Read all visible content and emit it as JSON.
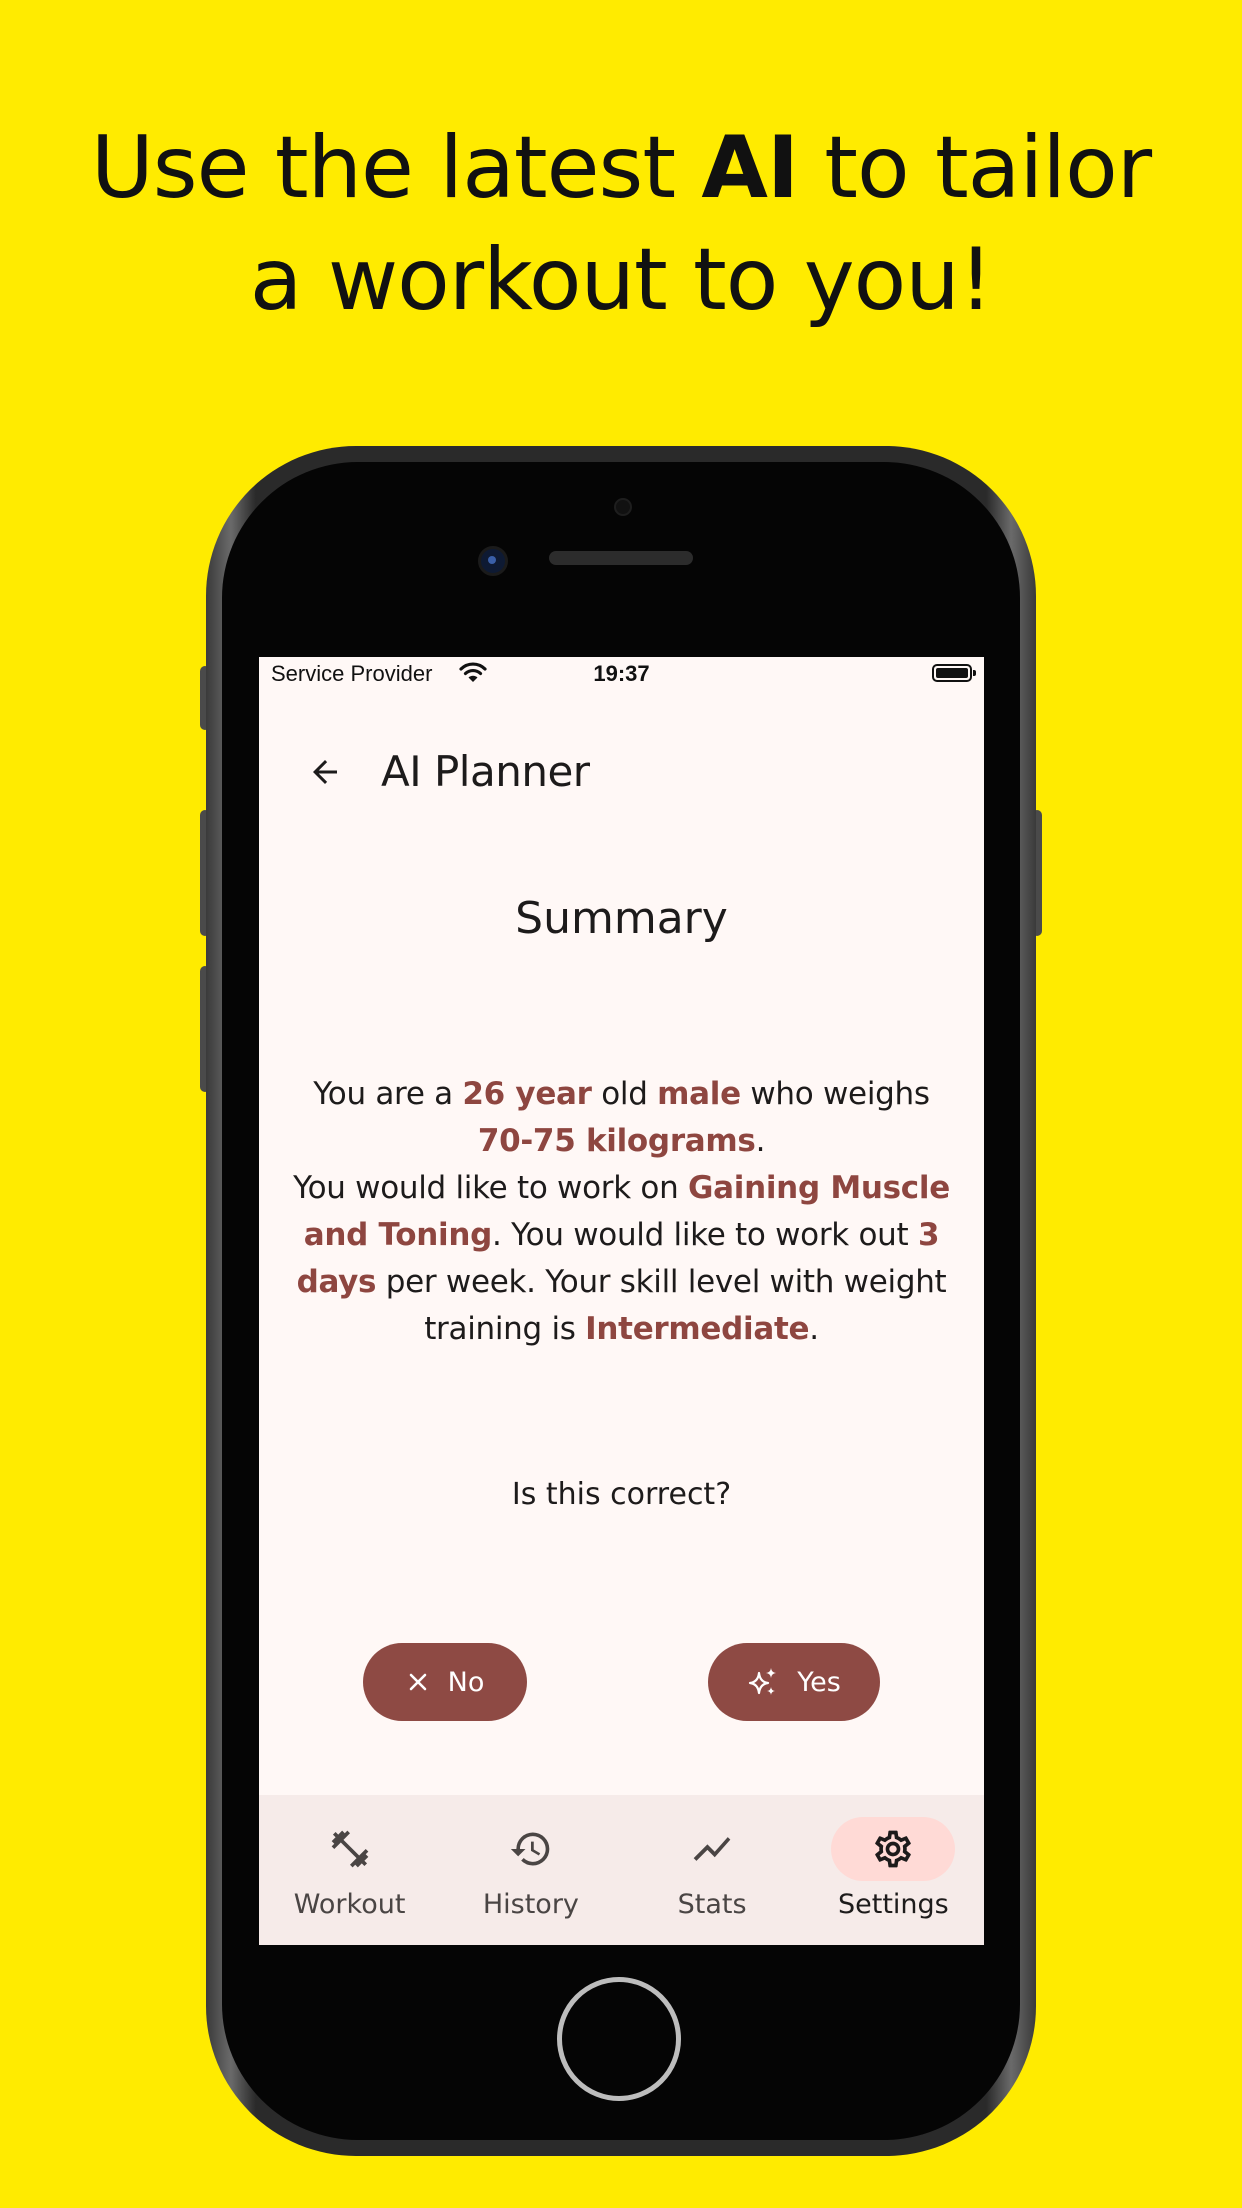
{
  "headline": {
    "line1_pre": "Use the latest ",
    "line1_bold": "AI",
    "line1_post": " to tailor",
    "line2": "a workout to you!"
  },
  "status_bar": {
    "provider": "Service Provider",
    "time": "19:37"
  },
  "app_bar": {
    "title": "AI Planner",
    "back_icon": "arrow-back-icon"
  },
  "summary": {
    "title": "Summary",
    "t1": "You are a ",
    "age": "26 year",
    "t2": " old ",
    "gender": "male",
    "t3": " who weighs ",
    "weight": "70-75 kilograms",
    "t4": ".",
    "t5": "You would like to work on ",
    "goal": "Gaining Muscle and Toning",
    "t6": ". You would like to work out ",
    "days": "3 days",
    "t7": " per week. Your skill level with weight training is ",
    "level": "Intermediate",
    "t8": "."
  },
  "question": "Is this correct?",
  "buttons": {
    "no_label": "No",
    "no_icon": "close-icon",
    "yes_label": "Yes",
    "yes_icon": "sparkles-icon"
  },
  "bottom_nav": {
    "items": [
      {
        "label": "Workout",
        "icon": "dumbbell-icon"
      },
      {
        "label": "History",
        "icon": "history-icon"
      },
      {
        "label": "Stats",
        "icon": "trending-icon"
      },
      {
        "label": "Settings",
        "icon": "gear-icon",
        "active": true
      }
    ]
  },
  "colors": {
    "background": "#FFEB00",
    "accent": "#8E4A44",
    "highlight": "#8E4640",
    "active_indicator": "#FFDAD6"
  }
}
